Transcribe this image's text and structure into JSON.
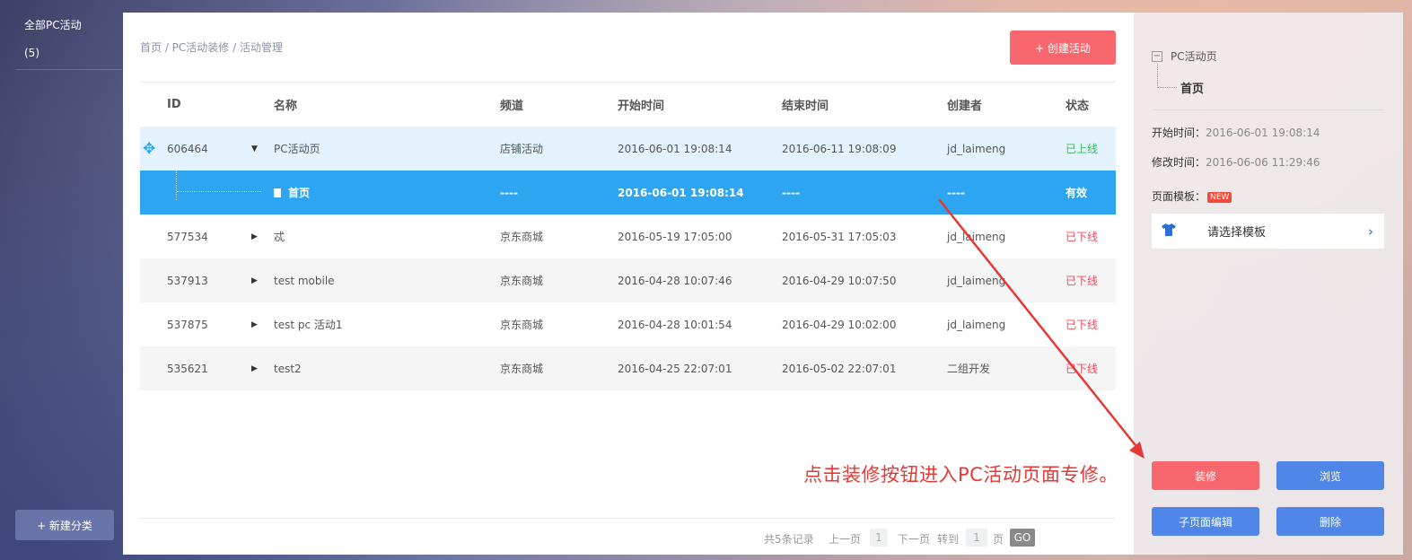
{
  "sidebar": {
    "category_title": "全部PC活动",
    "category_count": "(5)",
    "new_category_label": "+ 新建分类"
  },
  "header": {
    "breadcrumb": "首页 / PC活动装修 / 活动管理",
    "create_label": "+ 创建活动"
  },
  "table": {
    "columns": [
      "ID",
      "名称",
      "频道",
      "开始时间",
      "结束时间",
      "创建者",
      "状态"
    ],
    "rows": [
      {
        "id": "606464",
        "name": "PC活动页",
        "channel": "店铺活动",
        "start": "2016-06-01 19:08:14",
        "end": "2016-06-11 19:08:09",
        "creator": "jd_laimeng",
        "status": "已上线"
      },
      {
        "id": "",
        "name": "首页",
        "channel": "----",
        "start": "2016-06-01 19:08:14",
        "end": "----",
        "creator": "----",
        "status": "有效"
      },
      {
        "id": "577534",
        "name": "忒",
        "channel": "京东商城",
        "start": "2016-05-19 17:05:00",
        "end": "2016-05-31 17:05:03",
        "creator": "jd_laimeng",
        "status": "已下线"
      },
      {
        "id": "537913",
        "name": "test mobile",
        "channel": "京东商城",
        "start": "2016-04-28 10:07:46",
        "end": "2016-04-29 10:07:50",
        "creator": "jd_laimeng",
        "status": "已下线"
      },
      {
        "id": "537875",
        "name": "test pc 活动1",
        "channel": "京东商城",
        "start": "2016-04-28 10:01:54",
        "end": "2016-04-29 10:02:00",
        "creator": "jd_laimeng",
        "status": "已下线"
      },
      {
        "id": "535621",
        "name": "test2",
        "channel": "京东商城",
        "start": "2016-04-25 22:07:01",
        "end": "2016-05-02 22:07:01",
        "creator": "二组开发",
        "status": "已下线"
      }
    ]
  },
  "pager": {
    "total": "共5条记录",
    "prev": "上一页",
    "current_page": "1",
    "next": "下一页",
    "goto": "转到",
    "goto_value": "1",
    "page_unit": "页",
    "go": "GO"
  },
  "annotation": "点击装修按钮进入PC活动页面专修。",
  "detail": {
    "tree_root": "PC活动页",
    "tree_child": "首页",
    "start_label": "开始时间：",
    "start_value": "2016-06-01 19:08:14",
    "modify_label": "修改时间：",
    "modify_value": "2016-06-06 11:29:46",
    "template_label": "页面模板：",
    "new_badge": "NEW",
    "template_select": "请选择模板",
    "buttons": {
      "decorate": "装修",
      "browse": "浏览",
      "sub_edit": "子页面编辑",
      "delete": "删除"
    }
  },
  "colors": {
    "accent_red": "#f9676e",
    "accent_blue": "#4f86e8",
    "selected_row": "#2ea5f1",
    "status_online": "#3dbb5b",
    "status_offline": "#f44a5c"
  }
}
